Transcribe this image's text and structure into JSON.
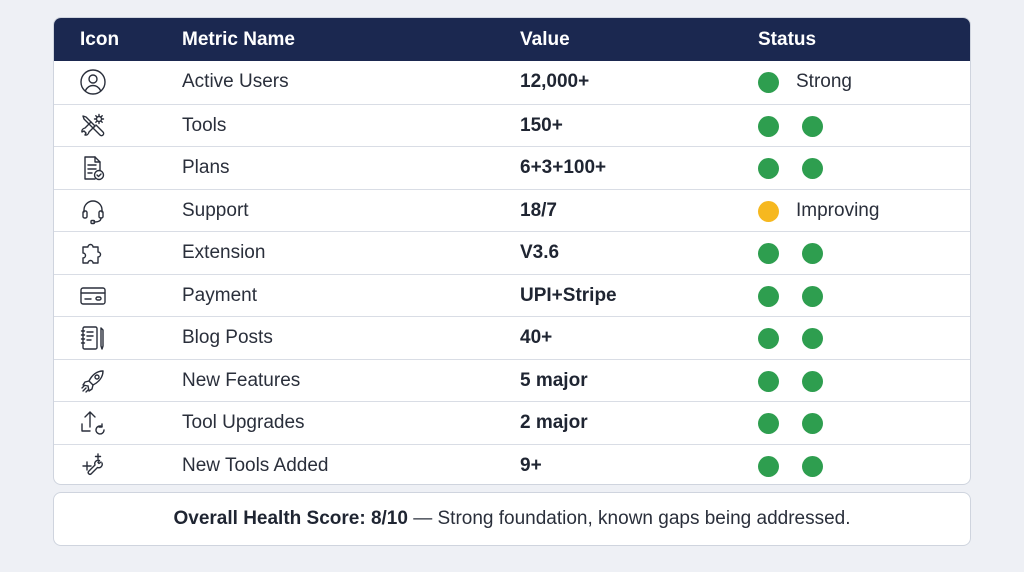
{
  "colors": {
    "header_bg": "#1b2850",
    "green": "#2e9e4f",
    "yellow": "#f6b81f"
  },
  "header": {
    "icon": "Icon",
    "metric": "Metric Name",
    "value": "Value",
    "status": "Status"
  },
  "rows": [
    {
      "icon": "user-circle-icon",
      "name": "Active Users",
      "value": "12,000+",
      "dots": [
        "green"
      ],
      "status_text": "Strong"
    },
    {
      "icon": "tools-icon",
      "name": "Tools",
      "value": "150+",
      "dots": [
        "green",
        "green"
      ],
      "status_text": ""
    },
    {
      "icon": "document-check-icon",
      "name": "Plans",
      "value": "6+3+100+",
      "dots": [
        "green",
        "green"
      ],
      "status_text": ""
    },
    {
      "icon": "headset-icon",
      "name": "Support",
      "value": "18/7",
      "dots": [
        "yellow"
      ],
      "status_text": "Improving"
    },
    {
      "icon": "puzzle-icon",
      "name": "Extension",
      "value": "V3.6",
      "dots": [
        "green",
        "green"
      ],
      "status_text": ""
    },
    {
      "icon": "credit-card-icon",
      "name": "Payment",
      "value": "UPI+Stripe",
      "dots": [
        "green",
        "green"
      ],
      "status_text": ""
    },
    {
      "icon": "notebook-pen-icon",
      "name": "Blog Posts",
      "value": "40+",
      "dots": [
        "green",
        "green"
      ],
      "status_text": ""
    },
    {
      "icon": "rocket-icon",
      "name": "New Features",
      "value": "5 major",
      "dots": [
        "green",
        "green"
      ],
      "status_text": ""
    },
    {
      "icon": "upload-refresh-icon",
      "name": "Tool Upgrades",
      "value": "2 major",
      "dots": [
        "green",
        "green"
      ],
      "status_text": ""
    },
    {
      "icon": "plus-wrench-icon",
      "name": "New Tools Added",
      "value": "9+",
      "dots": [
        "green",
        "green"
      ],
      "status_text": ""
    }
  ],
  "summary": {
    "label": "Overall Health Score: 8/10",
    "text": " — Strong foundation, known gaps being addressed."
  }
}
